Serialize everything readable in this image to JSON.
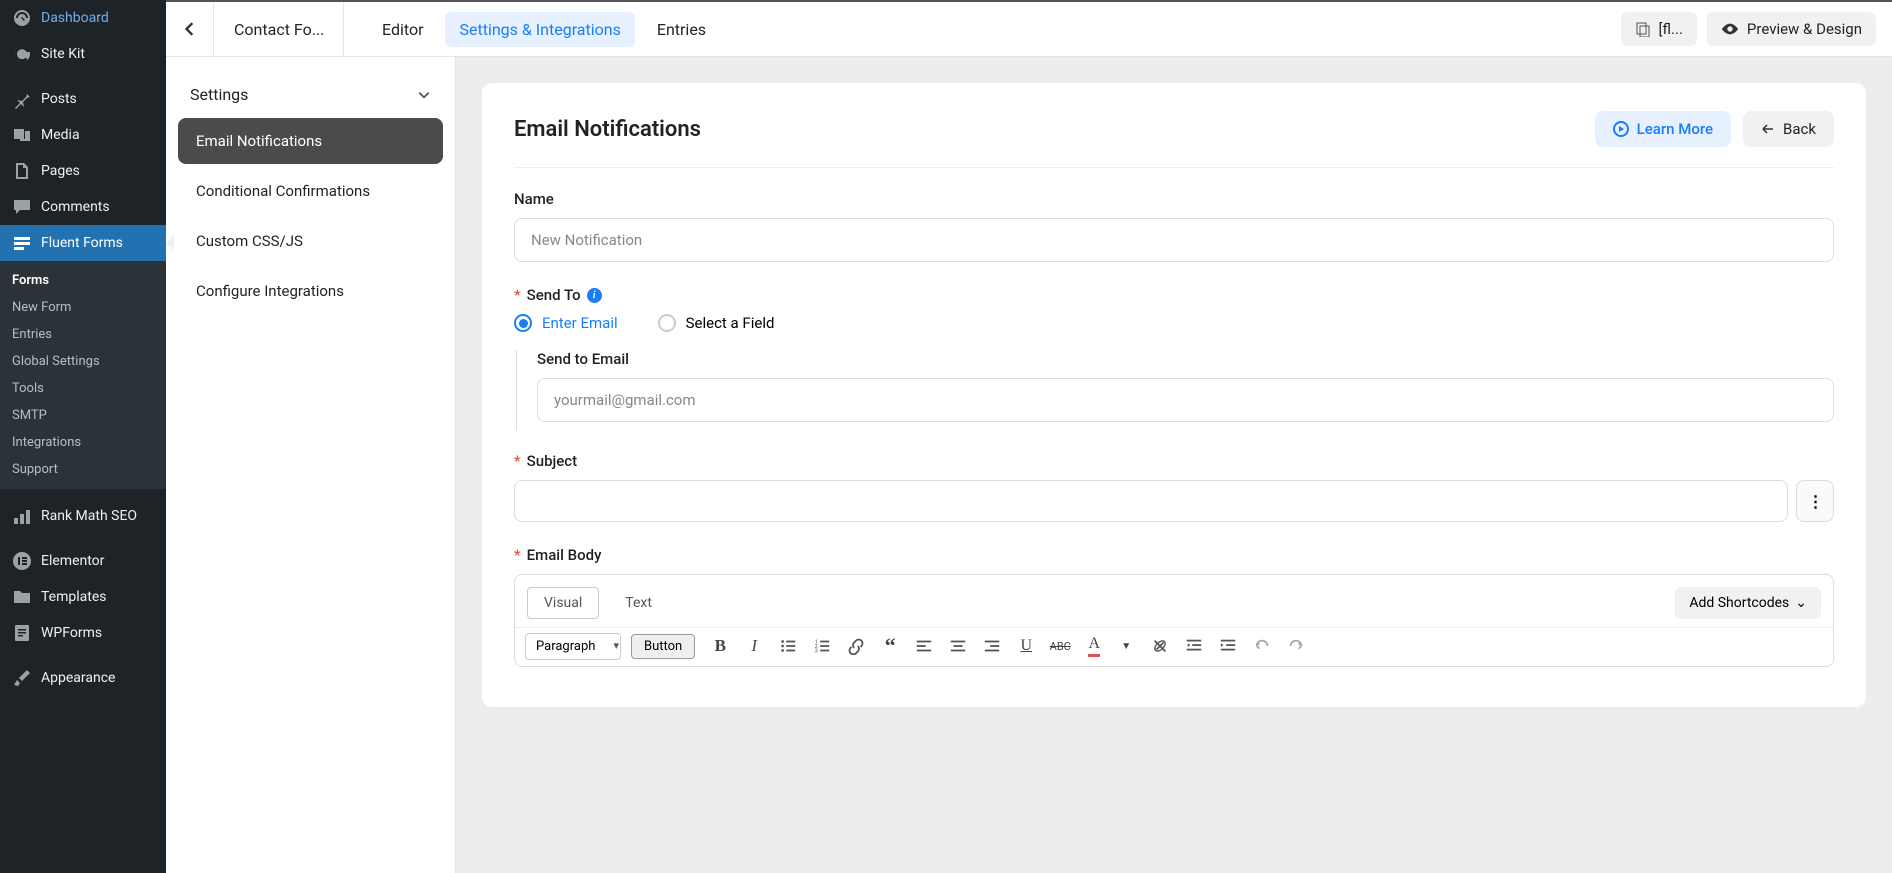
{
  "wp_sidebar": {
    "items": [
      {
        "label": "Dashboard",
        "icon": "dashboard"
      },
      {
        "label": "Site Kit",
        "icon": "sitekit"
      },
      {
        "label": "Posts",
        "icon": "pin",
        "spacer": true
      },
      {
        "label": "Media",
        "icon": "media"
      },
      {
        "label": "Pages",
        "icon": "pages"
      },
      {
        "label": "Comments",
        "icon": "comments"
      },
      {
        "label": "Fluent Forms",
        "icon": "form",
        "active": true
      },
      {
        "label": "Rank Math SEO",
        "icon": "seo",
        "spacer": true
      },
      {
        "label": "Elementor",
        "icon": "elementor",
        "spacer": true
      },
      {
        "label": "Templates",
        "icon": "templates"
      },
      {
        "label": "WPForms",
        "icon": "wpforms"
      },
      {
        "label": "Appearance",
        "icon": "appearance",
        "spacer": true
      }
    ],
    "sub": [
      "Forms",
      "New Form",
      "Entries",
      "Global Settings",
      "Tools",
      "SMTP",
      "Integrations",
      "Support"
    ]
  },
  "topbar": {
    "crumb": "Contact Fo...",
    "tabs": [
      "Editor",
      "Settings & Integrations",
      "Entries"
    ],
    "active_tab": 1,
    "flag_btn": "[fl...",
    "preview_btn": "Preview & Design"
  },
  "settings_panel": {
    "heading": "Settings",
    "items": [
      "Email Notifications",
      "Conditional Confirmations",
      "Custom CSS/JS",
      "Configure Integrations"
    ],
    "active": 0
  },
  "card": {
    "title": "Email Notifications",
    "learn_more": "Learn More",
    "back": "Back"
  },
  "form": {
    "name_label": "Name",
    "name_placeholder": "New Notification",
    "sendto_label": "Send To",
    "radio_email": "Enter Email",
    "radio_field": "Select a Field",
    "send_email_label": "Send to Email",
    "send_email_placeholder": "yourmail@gmail.com",
    "subject_label": "Subject",
    "body_label": "Email Body"
  },
  "editor": {
    "tab_visual": "Visual",
    "tab_text": "Text",
    "shortcodes": "Add Shortcodes",
    "paragraph": "Paragraph",
    "button": "Button"
  }
}
